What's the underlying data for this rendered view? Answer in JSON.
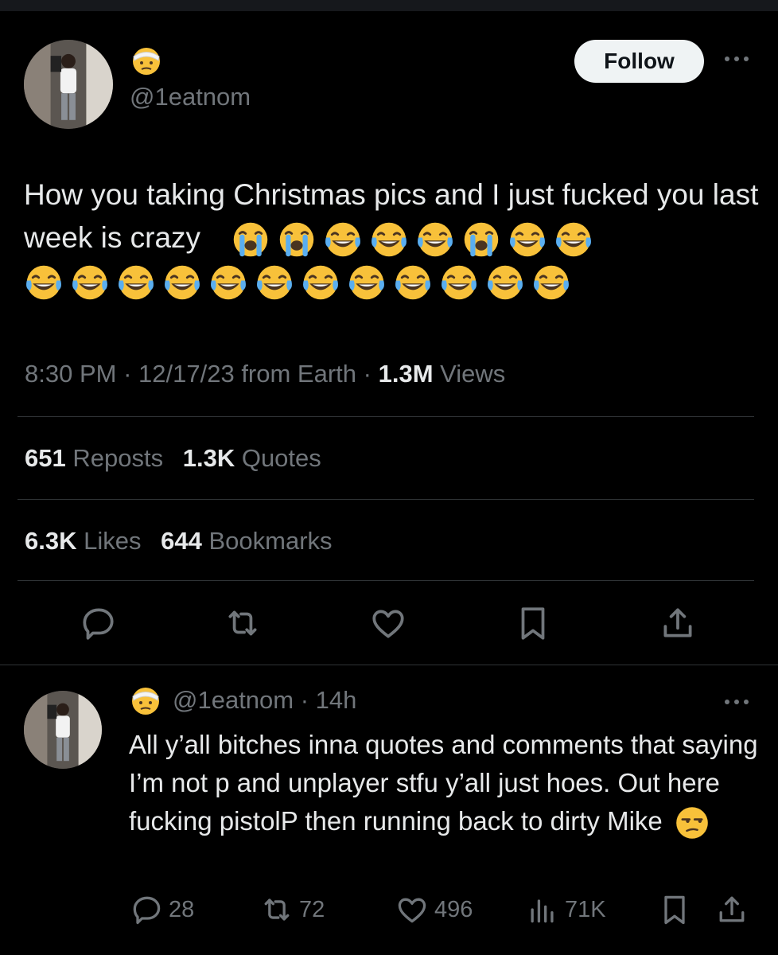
{
  "tweet": {
    "author_handle": "@1eatnom",
    "author_badge_icon": "face-with-head-bandage-emoji",
    "follow_label": "Follow",
    "text": "How you taking Christmas pics and I just fucked you last week is crazy",
    "emojis_line1": [
      "loudly-crying-face",
      "loudly-crying-face",
      "face-with-tears-of-joy",
      "face-with-tears-of-joy",
      "face-with-tears-of-joy",
      "loudly-crying-face",
      "face-with-tears-of-joy",
      "face-with-tears-of-joy"
    ],
    "emojis_line2": [
      "face-with-tears-of-joy",
      "face-with-tears-of-joy",
      "face-with-tears-of-joy",
      "face-with-tears-of-joy",
      "face-with-tears-of-joy",
      "face-with-tears-of-joy",
      "face-with-tears-of-joy",
      "face-with-tears-of-joy",
      "face-with-tears-of-joy",
      "face-with-tears-of-joy",
      "face-with-tears-of-joy",
      "face-with-tears-of-joy"
    ],
    "time": "8:30 PM",
    "date": "12/17/23",
    "location": "from Earth",
    "views_count": "1.3M",
    "views_label": "Views",
    "reposts_count": "651",
    "reposts_label": "Reposts",
    "quotes_count": "1.3K",
    "quotes_label": "Quotes",
    "likes_count": "6.3K",
    "likes_label": "Likes",
    "bookmarks_count": "644",
    "bookmarks_label": "Bookmarks",
    "actions": [
      "reply-icon",
      "repost-icon",
      "like-icon",
      "bookmark-icon",
      "share-icon"
    ]
  },
  "reply": {
    "author_handle": "@1eatnom",
    "time_ago": "14h",
    "author_badge_icon": "face-with-head-bandage-emoji",
    "text": "All y’all bitches inna quotes and comments that saying I’m not p and unplayer stfu y’all just hoes. Out here fucking pistolP then running back to dirty Mike",
    "end_emoji": "unamused-face",
    "reply_count": "28",
    "repost_count": "72",
    "like_count": "496",
    "views_count": "71K"
  },
  "colors": {
    "background": "#000000",
    "text_primary": "#e7e9ea",
    "text_secondary": "#71767b",
    "divider": "#2f3336",
    "follow_bg": "#eff3f4"
  }
}
